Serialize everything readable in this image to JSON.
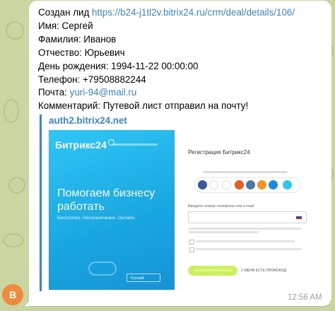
{
  "sender": {
    "avatar_letter": "B",
    "avatar_color": "#f08a3c"
  },
  "message": {
    "lead_prefix": "Создан лид",
    "lead_url": "https://b24-j1tl2v.bitrix24.ru/crm/deal/details/106/",
    "first_name": "Имя: Сергей",
    "last_name": "Фамилия: Иванов",
    "patronymic": "Отчество: Юрьевич",
    "birthday": "День рождения: 1994-11-22 00:00:00",
    "phone": "Телефон: +79508882244",
    "email_label": "Почта:",
    "email": "yuri-94@mail.ru",
    "comment": "Комментарий: Путевой лист отправил на почту!",
    "time": "12:56 AM"
  },
  "link_preview": {
    "site": "auth2.bitrix24.net",
    "logo_text": "Битрикс",
    "logo_num": "24",
    "promo_title": "Помогаем бизнесу работать",
    "promo_subtitle": "Бесплатно. Неограниченно. Онлайн.",
    "language": "Русский",
    "reg_title": "Регистрация Битрикс24",
    "phone_label": "Введите номер телефона или e-mail",
    "register_button": "ЗАРЕГИСТРИРОВАТЬСЯ",
    "promo_code": "У МЕНЯ ЕСТЬ ПРОМОКОД"
  },
  "colors": {
    "link": "#3a87cc",
    "wallpaper": "#c9d6a2",
    "promo": "#2fc6f6",
    "button": "#bbed21"
  }
}
